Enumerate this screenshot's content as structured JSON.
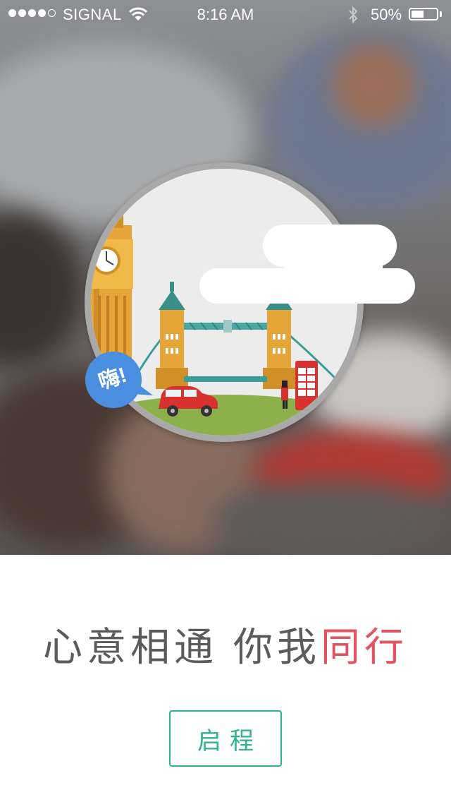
{
  "status_bar": {
    "carrier": "SIGNAL",
    "signal_bars_filled": 4,
    "signal_bars_total": 5,
    "time": "8:16 AM",
    "battery_percent": "50%",
    "battery_level": 0.5,
    "icons": [
      "wifi-icon",
      "bluetooth-icon",
      "battery-icon"
    ]
  },
  "illustration": {
    "speech_bubble_text": "嗨!",
    "scene": "london-tower-bridge"
  },
  "tagline": {
    "part1": "心意相通",
    "part2": "你我",
    "part3": "同行"
  },
  "start_button_label": "启程",
  "colors": {
    "accent_red": "#e05563",
    "accent_green": "#2fb28f",
    "bubble_blue": "#4a8ee0",
    "text_gray": "#5b5b5b"
  }
}
